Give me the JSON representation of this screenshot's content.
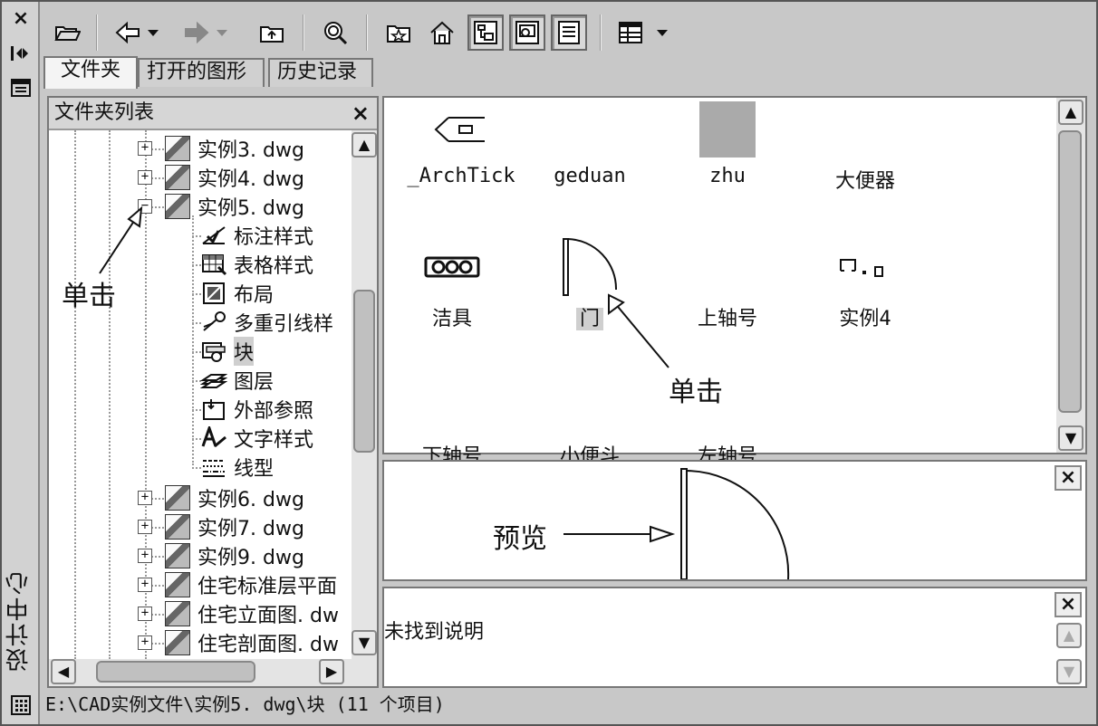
{
  "window": {
    "title": "设计中心"
  },
  "tabs": [
    {
      "label": "文件夹"
    },
    {
      "label": "打开的图形"
    },
    {
      "label": "历史记录"
    }
  ],
  "folder_panel": {
    "title": "文件夹列表",
    "nodes": [
      {
        "label": "实例3. dwg",
        "expander": "+"
      },
      {
        "label": "实例4. dwg",
        "expander": "+"
      },
      {
        "label": "实例5. dwg",
        "expander": "−"
      },
      {
        "label": "标注样式",
        "icon": "dimension-style-icon"
      },
      {
        "label": "表格样式",
        "icon": "table-style-icon"
      },
      {
        "label": "布局",
        "icon": "layout-icon"
      },
      {
        "label": "多重引线样",
        "icon": "multileader-icon"
      },
      {
        "label": "块",
        "icon": "block-icon",
        "selected": true
      },
      {
        "label": "图层",
        "icon": "layer-icon"
      },
      {
        "label": "外部参照",
        "icon": "xref-icon"
      },
      {
        "label": "文字样式",
        "icon": "text-style-icon"
      },
      {
        "label": "线型",
        "icon": "linetype-icon"
      },
      {
        "label": "实例6. dwg",
        "expander": "+"
      },
      {
        "label": "实例7. dwg",
        "expander": "+"
      },
      {
        "label": "实例9. dwg",
        "expander": "+"
      },
      {
        "label": "住宅标准层平面",
        "expander": "+"
      },
      {
        "label": "住宅立面图. dw",
        "expander": "+"
      },
      {
        "label": "住宅剖面图. dw",
        "expander": "+"
      }
    ]
  },
  "content_items": [
    {
      "label": "_ArchTick"
    },
    {
      "label": "geduan"
    },
    {
      "label": "zhu"
    },
    {
      "label": "大便器"
    },
    {
      "label": "洁具"
    },
    {
      "label": "门",
      "selected": true
    },
    {
      "label": "上轴号"
    },
    {
      "label": "实例4"
    },
    {
      "label": "下轴号"
    },
    {
      "label": "小便斗"
    },
    {
      "label": "左轴号"
    }
  ],
  "description": {
    "text": "未找到说明"
  },
  "status": {
    "text": "E:\\CAD实例文件\\实例5. dwg\\块 (11 个项目)"
  },
  "annotations": {
    "click1": "单击",
    "click2": "单击",
    "preview": "预览"
  },
  "toolbar": {
    "close": "×",
    "scroll_up": "▲",
    "scroll_down": "▼",
    "scroll_left": "◀",
    "scroll_right": "▶"
  },
  "colors": {
    "background": "#c8c8c8",
    "panel": "#ffffff",
    "selection": "#cfcfcf"
  }
}
